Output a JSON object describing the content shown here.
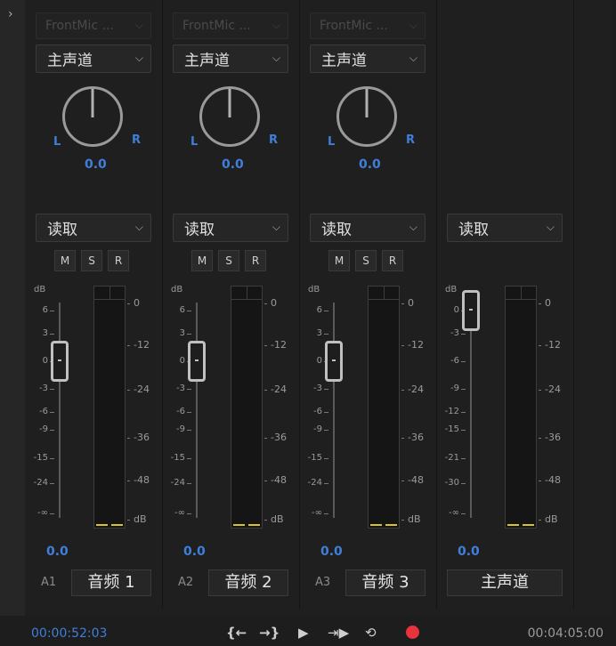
{
  "panel": {
    "expand_icon": "chevron-right-icon"
  },
  "channels": [
    {
      "input": "FrontMic ...",
      "routing": "主声道",
      "pan_left": "L",
      "pan_right": "R",
      "pan_value": "0.0",
      "mode": "读取",
      "m": "M",
      "s": "S",
      "r": "R",
      "db": "dB",
      "fader_scale": [
        "6",
        "3",
        "0",
        "-3",
        "-6",
        "-9",
        "-15",
        "-24",
        "-∞"
      ],
      "meter_scale": [
        "0",
        "-12",
        "-24",
        "-36",
        "-48",
        "dB"
      ],
      "fader_level_db": 0,
      "gain": "0.0",
      "track_id": "A1",
      "track_name": "音频 1"
    },
    {
      "input": "FrontMic ...",
      "routing": "主声道",
      "pan_left": "L",
      "pan_right": "R",
      "pan_value": "0.0",
      "mode": "读取",
      "m": "M",
      "s": "S",
      "r": "R",
      "db": "dB",
      "fader_scale": [
        "6",
        "3",
        "0",
        "-3",
        "-6",
        "-9",
        "-15",
        "-24",
        "-∞"
      ],
      "meter_scale": [
        "0",
        "-12",
        "-24",
        "-36",
        "-48",
        "dB"
      ],
      "fader_level_db": 0,
      "gain": "0.0",
      "track_id": "A2",
      "track_name": "音频 2"
    },
    {
      "input": "FrontMic ...",
      "routing": "主声道",
      "pan_left": "L",
      "pan_right": "R",
      "pan_value": "0.0",
      "mode": "读取",
      "m": "M",
      "s": "S",
      "r": "R",
      "db": "dB",
      "fader_scale": [
        "6",
        "3",
        "0",
        "-3",
        "-6",
        "-9",
        "-15",
        "-24",
        "-∞"
      ],
      "meter_scale": [
        "0",
        "-12",
        "-24",
        "-36",
        "-48",
        "dB"
      ],
      "fader_level_db": 0,
      "gain": "0.0",
      "track_id": "A3",
      "track_name": "音频 3"
    }
  ],
  "master": {
    "mode": "读取",
    "db": "dB",
    "fader_scale": [
      "0",
      "-3",
      "-6",
      "-9",
      "-12",
      "-15",
      "-21",
      "-30",
      "-∞"
    ],
    "meter_scale": [
      "0",
      "-12",
      "-24",
      "-36",
      "-48",
      "dB"
    ],
    "fader_level_db": 0,
    "gain": "0.0",
    "name": "主声道"
  },
  "transport": {
    "current_time": "00:00:52:03",
    "duration": "00:04:05:00",
    "buttons": [
      "go-to-in-icon",
      "go-to-out-icon",
      "play-icon",
      "play-in-to-out-icon",
      "loop-icon",
      "record-icon"
    ]
  },
  "colors": {
    "accent": "#3f7fd9",
    "record": "#e8323c",
    "meter_level": "#d9c32c"
  }
}
